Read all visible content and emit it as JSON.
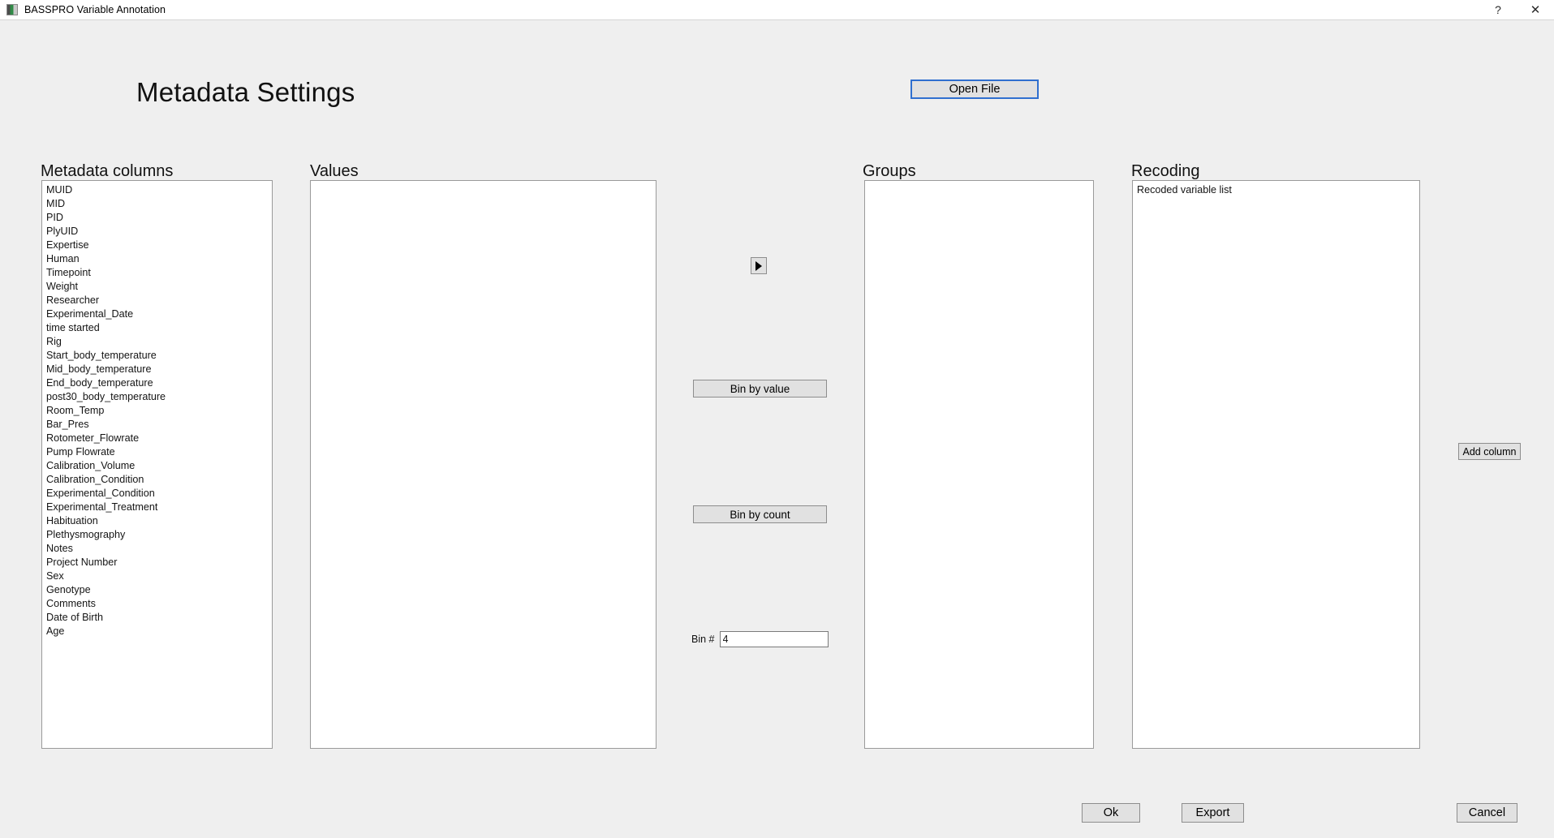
{
  "window": {
    "title": "BASSPRO Variable Annotation",
    "help_label": "?",
    "close_label": "✕"
  },
  "header": {
    "page_title": "Metadata Settings",
    "open_file_label": "Open File"
  },
  "panels": {
    "metadata_columns": {
      "label": "Metadata columns",
      "items": [
        "MUID",
        "MID",
        "PID",
        "PlyUID",
        "Expertise",
        "Human",
        "Timepoint",
        "Weight",
        "Researcher",
        "Experimental_Date",
        "time started",
        "Rig",
        "Start_body_temperature",
        "Mid_body_temperature",
        "End_body_temperature",
        "post30_body_temperature",
        "Room_Temp",
        "Bar_Pres",
        "Rotometer_Flowrate",
        "Pump Flowrate",
        "Calibration_Volume",
        "Calibration_Condition",
        "Experimental_Condition",
        "Experimental_Treatment",
        "Habituation",
        "Plethysmography",
        "Notes",
        "Project Number",
        "Sex",
        "Genotype",
        "Comments",
        "Date of Birth",
        "Age"
      ]
    },
    "values": {
      "label": "Values",
      "items": []
    },
    "groups": {
      "label": "Groups",
      "items": []
    },
    "recoding": {
      "label": "Recoding",
      "items": [
        "Recoded variable list"
      ]
    }
  },
  "controls": {
    "move_arrow_label": "▶",
    "bin_by_value_label": "Bin by value",
    "bin_by_count_label": "Bin by count",
    "bin_number_label": "Bin #",
    "bin_number_value": "4",
    "add_column_label": "Add column"
  },
  "footer": {
    "ok_label": "Ok",
    "export_label": "Export",
    "cancel_label": "Cancel"
  },
  "colors": {
    "window_background": "#efefef",
    "panel_background": "#ffffff",
    "panel_border": "#9a9a9a",
    "button_face": "#e1e1e1",
    "focus_border": "#2f6fcf",
    "titlebar_background": "#ffffff"
  }
}
